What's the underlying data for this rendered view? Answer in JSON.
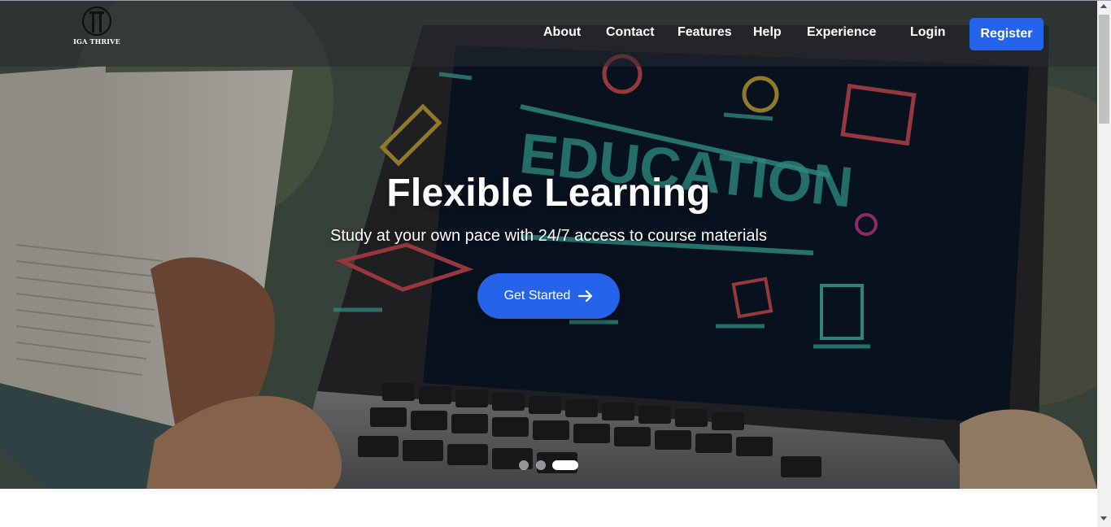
{
  "brand": {
    "name": "IGA THRIVE",
    "logo_icon": "tt-monogram-icon"
  },
  "nav": {
    "links": [
      "About",
      "Contact",
      "Features",
      "Help",
      "Experience"
    ],
    "login_label": "Login",
    "register_label": "Register"
  },
  "hero": {
    "title": "Flexible Learning",
    "subtitle": "Study at your own pace with 24/7 access to course materials",
    "cta_label": "Get Started",
    "cta_icon": "arrow-right-icon",
    "screen_word": "EDUCATION"
  },
  "carousel": {
    "slide_count": 3,
    "active_slide": 3
  },
  "colors": {
    "primary": "#2563eb",
    "nav_overlay": "rgba(40,42,48,0.55)"
  }
}
